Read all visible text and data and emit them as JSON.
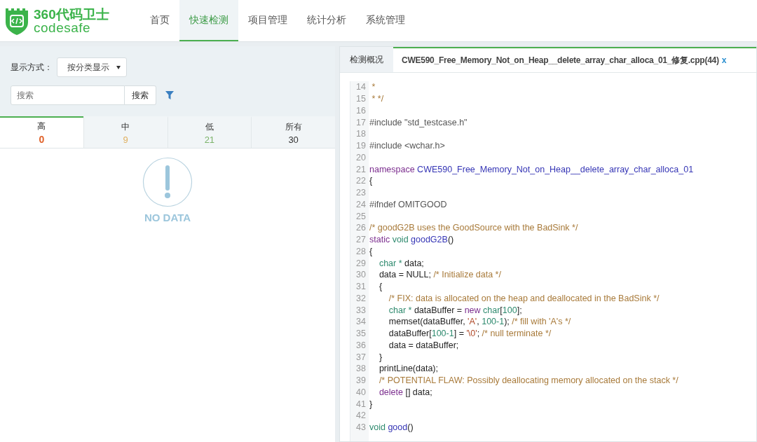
{
  "logo": {
    "title": "360代码卫士",
    "subtitle": "codesafe"
  },
  "nav": [
    {
      "label": "首页",
      "selected": false
    },
    {
      "label": "快速检测",
      "selected": true
    },
    {
      "label": "项目管理",
      "selected": false
    },
    {
      "label": "统计分析",
      "selected": false
    },
    {
      "label": "系统管理",
      "selected": false
    }
  ],
  "filters": {
    "display_label": "显示方式：",
    "display_value": "按分类显示",
    "search_placeholder": "搜索",
    "search_button": "搜索"
  },
  "severity_tabs": [
    {
      "label": "高",
      "count": "0",
      "color": "#e0622a",
      "selected": true
    },
    {
      "label": "中",
      "count": "9",
      "color": "#e0b060",
      "selected": false
    },
    {
      "label": "低",
      "count": "21",
      "color": "#7cb36a",
      "selected": false
    },
    {
      "label": "所有",
      "count": "30",
      "color": "#333333",
      "selected": false
    }
  ],
  "empty_state": {
    "text": "NO DATA"
  },
  "editor_tabs": [
    {
      "label": "检测概况",
      "selected": false,
      "closable": false
    },
    {
      "label": "CWE590_Free_Memory_Not_on_Heap__delete_array_char_alloca_01_修复.cpp(44)",
      "selected": true,
      "closable": true,
      "close": "x"
    }
  ],
  "code_lines": [
    {
      "number": "14",
      "tokens": [
        {
          "kind": "comment",
          "text": " *"
        }
      ]
    },
    {
      "number": "15",
      "tokens": [
        {
          "kind": "comment",
          "text": " * */"
        }
      ]
    },
    {
      "number": "16"
    },
    {
      "number": "17",
      "tokens": [
        {
          "kind": "preproc",
          "text": "#include \"std_testcase.h\""
        }
      ]
    },
    {
      "number": "18"
    },
    {
      "number": "19",
      "tokens": [
        {
          "kind": "preproc",
          "text": "#include <wchar.h>"
        }
      ]
    },
    {
      "number": "20"
    },
    {
      "number": "21",
      "tokens": [
        {
          "kind": "keyword",
          "text": "namespace "
        },
        {
          "kind": "name",
          "text": "CWE590_Free_Memory_Not_on_Heap__delete_array_char_alloca_01"
        }
      ]
    },
    {
      "number": "22",
      "tokens": [
        {
          "kind": "plain",
          "text": "{"
        }
      ]
    },
    {
      "number": "23"
    },
    {
      "number": "24",
      "tokens": [
        {
          "kind": "preproc",
          "text": "#ifndef OMITGOOD"
        }
      ]
    },
    {
      "number": "25"
    },
    {
      "number": "26",
      "tokens": [
        {
          "kind": "comment",
          "text": "/* goodG2B uses the GoodSource with the BadSink */"
        }
      ]
    },
    {
      "number": "27",
      "tokens": [
        {
          "kind": "keyword",
          "text": "static "
        },
        {
          "kind": "type",
          "text": "void "
        },
        {
          "kind": "name",
          "text": "goodG2B"
        },
        {
          "kind": "plain",
          "text": "()"
        }
      ]
    },
    {
      "number": "28",
      "tokens": [
        {
          "kind": "plain",
          "text": "{"
        }
      ]
    },
    {
      "number": "29",
      "tokens": [
        {
          "kind": "type",
          "text": "    char * "
        },
        {
          "kind": "plain",
          "text": "data;"
        }
      ]
    },
    {
      "number": "30",
      "tokens": [
        {
          "kind": "plain",
          "text": "    data = NULL; "
        },
        {
          "kind": "comment",
          "text": "/* Initialize data */"
        }
      ]
    },
    {
      "number": "31",
      "tokens": [
        {
          "kind": "plain",
          "text": "    {"
        }
      ]
    },
    {
      "number": "32",
      "tokens": [
        {
          "kind": "comment",
          "text": "        /* FIX: data is allocated on the heap and deallocated in the BadSink */"
        }
      ]
    },
    {
      "number": "33",
      "tokens": [
        {
          "kind": "type",
          "text": "        char * "
        },
        {
          "kind": "plain",
          "text": "dataBuffer = "
        },
        {
          "kind": "keyword",
          "text": "new "
        },
        {
          "kind": "type",
          "text": "char"
        },
        {
          "kind": "plain",
          "text": "["
        },
        {
          "kind": "number",
          "text": "100"
        },
        {
          "kind": "plain",
          "text": "];"
        }
      ]
    },
    {
      "number": "34",
      "tokens": [
        {
          "kind": "plain",
          "text": "        memset(dataBuffer, "
        },
        {
          "kind": "string",
          "text": "'A'"
        },
        {
          "kind": "plain",
          "text": ", "
        },
        {
          "kind": "number",
          "text": "100-1"
        },
        {
          "kind": "plain",
          "text": "); "
        },
        {
          "kind": "comment",
          "text": "/* fill with 'A's */"
        }
      ]
    },
    {
      "number": "35",
      "tokens": [
        {
          "kind": "plain",
          "text": "        dataBuffer["
        },
        {
          "kind": "number",
          "text": "100-1"
        },
        {
          "kind": "plain",
          "text": "] = "
        },
        {
          "kind": "string",
          "text": "'\\0'"
        },
        {
          "kind": "plain",
          "text": "; "
        },
        {
          "kind": "comment",
          "text": "/* null terminate */"
        }
      ]
    },
    {
      "number": "36",
      "tokens": [
        {
          "kind": "plain",
          "text": "        data = dataBuffer;"
        }
      ]
    },
    {
      "number": "37",
      "tokens": [
        {
          "kind": "plain",
          "text": "    }"
        }
      ]
    },
    {
      "number": "38",
      "tokens": [
        {
          "kind": "plain",
          "text": "    printLine(data);"
        }
      ]
    },
    {
      "number": "39",
      "tokens": [
        {
          "kind": "comment",
          "text": "    /* POTENTIAL FLAW: Possibly deallocating memory allocated on the stack */"
        }
      ]
    },
    {
      "number": "40",
      "tokens": [
        {
          "kind": "keyword",
          "text": "    delete "
        },
        {
          "kind": "plain",
          "text": "[] data;"
        }
      ]
    },
    {
      "number": "41",
      "tokens": [
        {
          "kind": "plain",
          "text": "}"
        }
      ]
    },
    {
      "number": "42"
    },
    {
      "number": "43",
      "tokens": [
        {
          "kind": "type",
          "text": "void "
        },
        {
          "kind": "name",
          "text": "good"
        },
        {
          "kind": "plain",
          "text": "()"
        }
      ]
    }
  ]
}
